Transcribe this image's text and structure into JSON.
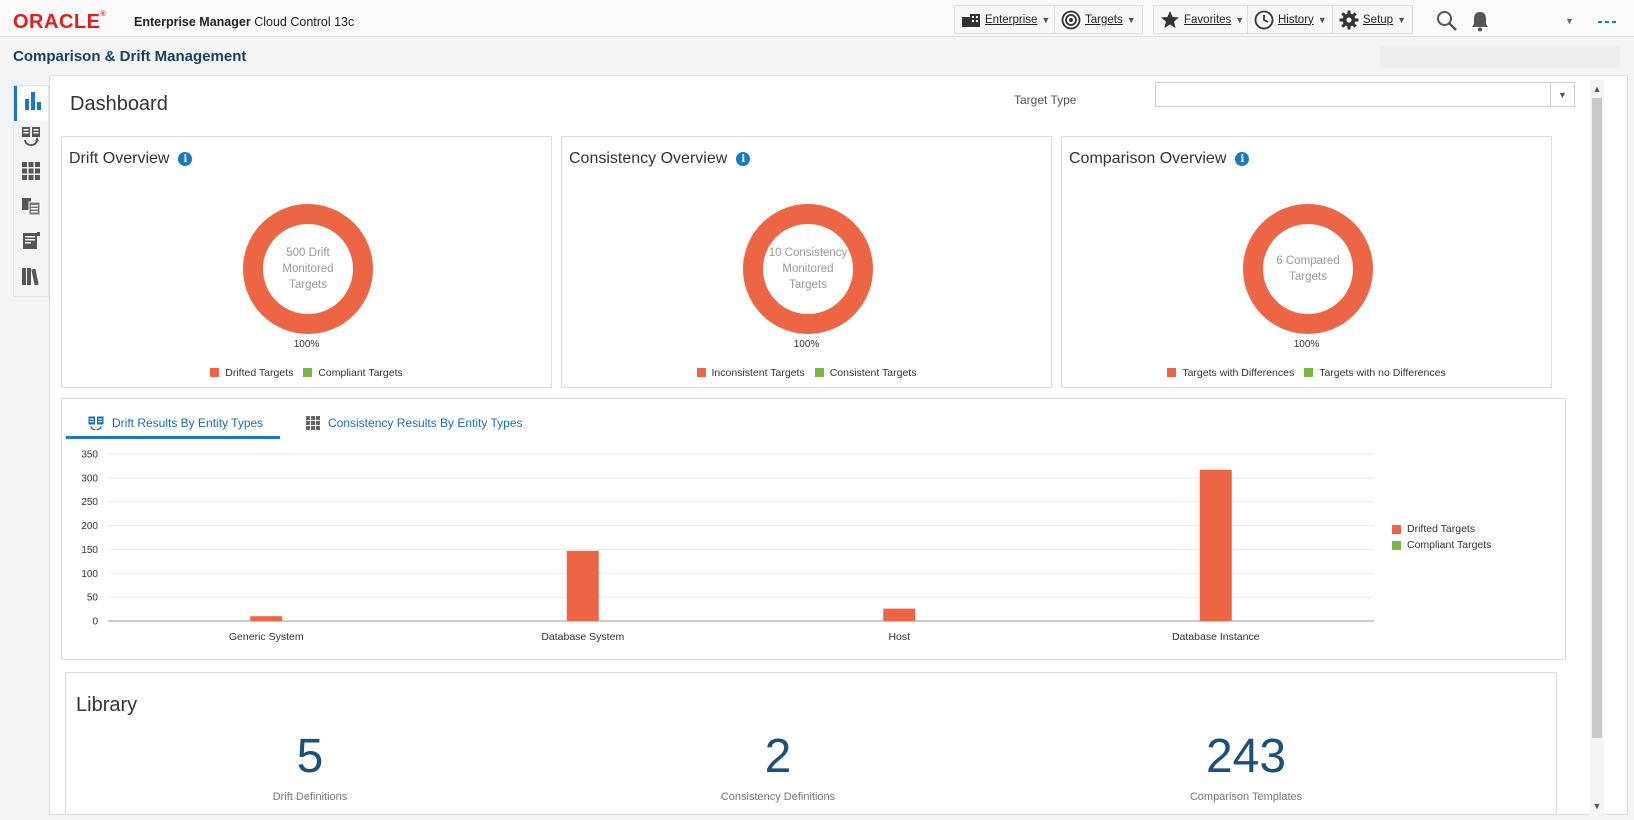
{
  "header": {
    "logo": "ORACLE",
    "logo_mark": "®",
    "product_name": "Enterprise Manager",
    "product_edition": "Cloud Control 13c",
    "nav": [
      {
        "label": "Enterprise",
        "icon": "enterprise-icon"
      },
      {
        "label": "Targets",
        "icon": "targets-icon"
      },
      {
        "label": "Favorites",
        "icon": "star-icon"
      },
      {
        "label": "History",
        "icon": "clock-icon"
      },
      {
        "label": "Setup",
        "icon": "gear-icon"
      }
    ],
    "icons": [
      "search-icon",
      "bell-icon",
      "user-menu-caret-icon",
      "more-icon"
    ]
  },
  "page": {
    "title": "Comparison & Drift Management"
  },
  "leftnav": [
    "dashboard-icon",
    "drift-icon",
    "consistency-icon",
    "comparison-icon",
    "templates-icon",
    "library-icon"
  ],
  "dashboard": {
    "title": "Dashboard",
    "target_type_label": "Target Type",
    "target_type_value": ""
  },
  "cards": [
    {
      "title": "Drift Overview",
      "center_text": "500 Drift Monitored Targets",
      "percent": "100%",
      "legend": [
        {
          "label": "Drifted Targets",
          "color": "#ec6545"
        },
        {
          "label": "Compliant Targets",
          "color": "#76b843"
        }
      ]
    },
    {
      "title": "Consistency Overview",
      "center_text": "10 Consistency Monitored Targets",
      "percent": "100%",
      "legend": [
        {
          "label": "Inconsistent Targets",
          "color": "#ec6545"
        },
        {
          "label": "Consistent Targets",
          "color": "#76b843"
        }
      ]
    },
    {
      "title": "Comparison Overview",
      "center_text": "6 Compared Targets",
      "percent": "100%",
      "legend": [
        {
          "label": "Targets with Differences",
          "color": "#ec6545"
        },
        {
          "label": "Targets with no Differences",
          "color": "#76b843"
        }
      ]
    }
  ],
  "tabs": [
    {
      "label": "Drift Results By Entity Types",
      "icon": "drift-tab-icon",
      "active": true
    },
    {
      "label": "Consistency Results By Entity Types",
      "icon": "grid-tab-icon",
      "active": false
    }
  ],
  "chart_data": {
    "type": "bar",
    "categories": [
      "Generic System",
      "Database System",
      "Host",
      "Database Instance"
    ],
    "series": [
      {
        "name": "Drifted Targets",
        "values": [
          10,
          147,
          26,
          317
        ],
        "color": "#ec6545"
      },
      {
        "name": "Compliant Targets",
        "values": [
          0,
          0,
          0,
          0
        ],
        "color": "#76b843"
      }
    ],
    "yticks": [
      0,
      50,
      100,
      150,
      200,
      250,
      300,
      350
    ],
    "ylim": [
      0,
      350
    ],
    "grid": true,
    "legend_position": "right"
  },
  "library": {
    "title": "Library",
    "items": [
      {
        "value": "5",
        "caption": "Drift Definitions"
      },
      {
        "value": "2",
        "caption": "Consistency Definitions"
      },
      {
        "value": "243",
        "caption": "Comparison Templates"
      }
    ]
  }
}
